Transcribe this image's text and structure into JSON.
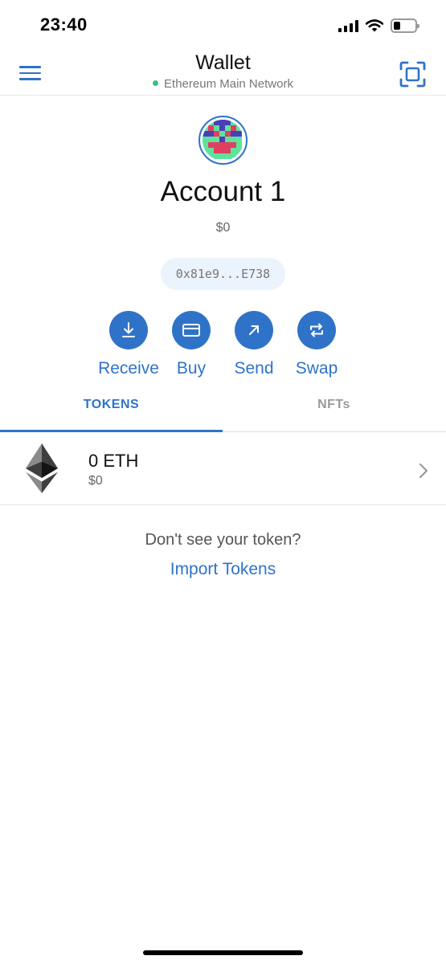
{
  "status_bar": {
    "time": "23:40",
    "battery_level": 0.3
  },
  "header": {
    "title": "Wallet",
    "network": "Ethereum Main Network",
    "network_color": "#3dbf86"
  },
  "account": {
    "name": "Account 1",
    "balance": "$0",
    "address": "0x81e9...E738"
  },
  "actions": [
    {
      "label": "Receive",
      "icon": "download-icon"
    },
    {
      "label": "Buy",
      "icon": "card-icon"
    },
    {
      "label": "Send",
      "icon": "arrow-up-right-icon"
    },
    {
      "label": "Swap",
      "icon": "swap-icon"
    }
  ],
  "tabs": {
    "tokens": "TOKENS",
    "nfts": "NFTs",
    "active": "tokens"
  },
  "tokens": [
    {
      "amount": "0 ETH",
      "fiat": "$0",
      "icon": "ethereum-icon"
    }
  ],
  "import": {
    "prompt": "Don't see your token?",
    "link": "Import Tokens"
  },
  "colors": {
    "accent": "#2f73c9",
    "pill_bg": "#ebf3fc"
  }
}
